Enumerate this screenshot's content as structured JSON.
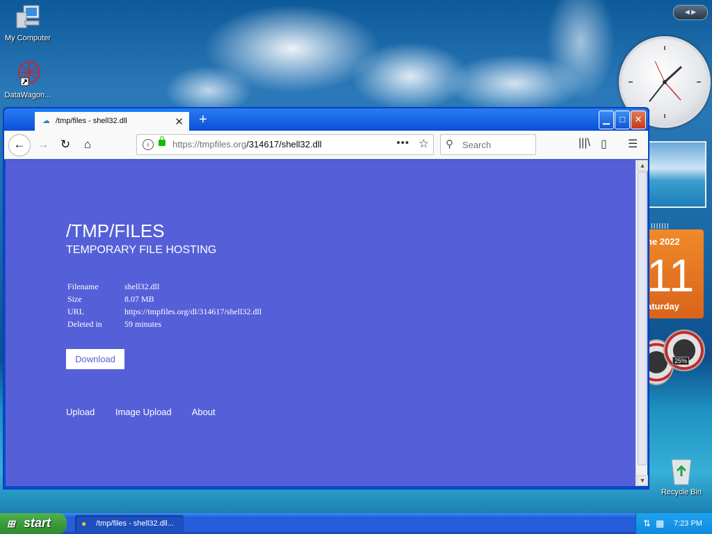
{
  "desktop": {
    "icons": [
      {
        "label": "My Computer"
      },
      {
        "label": "DataWagon..."
      }
    ],
    "calendar": {
      "month": "ne 2022",
      "day": "11",
      "weekday": "aturday"
    },
    "meter_badge": "25%",
    "recycle_bin": "Recycle Bin"
  },
  "browser": {
    "tab_title": "/tmp/files - shell32.dll",
    "url": "https://tmpfiles.org/314617/shell32.dll",
    "url_host": "https://tmpfiles.org",
    "url_path": "/314617/shell32.dll",
    "search_placeholder": "Search"
  },
  "page": {
    "title": "/TMP/FILES",
    "subtitle": "TEMPORARY FILE HOSTING",
    "info": [
      {
        "key": "Filename",
        "value": "shell32.dll"
      },
      {
        "key": "Size",
        "value": "8.07 MB"
      },
      {
        "key": "URL",
        "value": "https://tmpfiles.org/dl/314617/shell32.dll"
      },
      {
        "key": "Deleted in",
        "value": "59 minutes"
      }
    ],
    "download_label": "Download",
    "footer_links": [
      "Upload",
      "Image Upload",
      "About"
    ],
    "background_color": "#5560d8"
  },
  "taskbar": {
    "start_label": "start",
    "task_label": "/tmp/files - shell32.dll...",
    "clock": "7:23 PM"
  }
}
